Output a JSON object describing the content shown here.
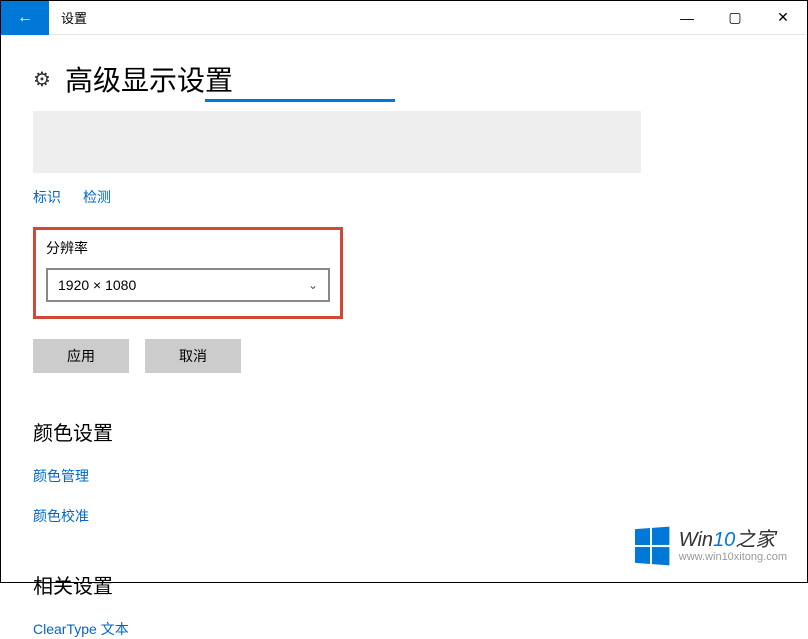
{
  "window": {
    "title": "设置"
  },
  "page": {
    "title": "高级显示设置"
  },
  "links": {
    "identify": "标识",
    "detect": "检测"
  },
  "resolution": {
    "label": "分辨率",
    "value": "1920 × 1080"
  },
  "buttons": {
    "apply": "应用",
    "cancel": "取消"
  },
  "sections": {
    "color": {
      "title": "颜色设置",
      "links": {
        "management": "颜色管理",
        "calibration": "颜色校准"
      }
    },
    "related": {
      "title": "相关设置",
      "links": {
        "cleartype": "ClearType 文本"
      }
    }
  },
  "watermark": {
    "brand_prefix": "Win",
    "brand_accent": "10",
    "brand_suffix": "之家",
    "url": "www.win10xitong.com"
  }
}
